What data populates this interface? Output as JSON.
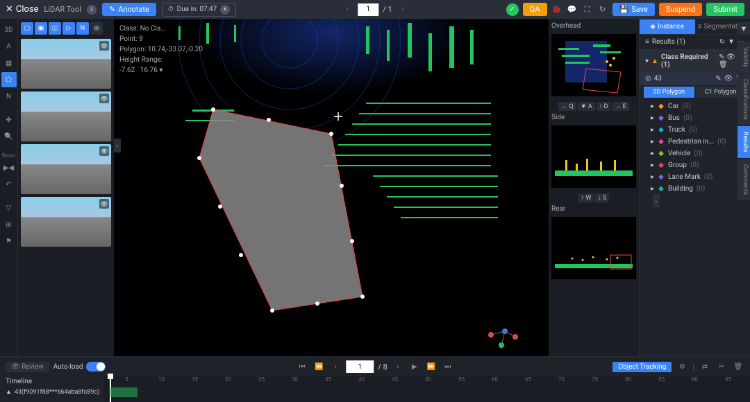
{
  "topbar": {
    "close": "Close",
    "tool_name": "LiDAR Tool",
    "annotate": "Annotate",
    "due_label": "Due in: 07:47",
    "page_current": "1",
    "page_total": "/ 1",
    "qa": "QA",
    "save": "Save",
    "suspend": "Suspend",
    "submit": "Submit"
  },
  "canvas_info": {
    "class_label": "Class:",
    "class_value": "No Cla...",
    "point_label": "Point:",
    "point_value": "9",
    "polygon_label": "Polygon:",
    "polygon_value": "10.74,-33.07,-0.20",
    "height_label": "Height Range:",
    "height_min": "-7.62",
    "height_max": "16.76"
  },
  "side_views": {
    "overhead": "Overhead",
    "side": "Side",
    "rear": "Rear",
    "keys_overhead": [
      "← Q",
      "▼ A",
      "↑ D",
      "→ E"
    ],
    "keys_side": [
      "↑ W",
      "↓ S"
    ]
  },
  "left_tools": {
    "basic_label": "Basic"
  },
  "right_panel": {
    "tab_instance": "Instance",
    "tab_segmentation": "Segmentation",
    "results_label": "Results (1)",
    "class_required": "Class Required (1)",
    "item_id": "43",
    "subtab_3d": "3D Polygon",
    "subtab_c1": "C1 Polygon",
    "classes": [
      {
        "name": "Car",
        "count": "(0)",
        "color": "#f59e0b"
      },
      {
        "name": "Bus",
        "count": "(0)",
        "color": "#a855f7"
      },
      {
        "name": "Truck",
        "count": "(0)",
        "color": "#06b6d4"
      },
      {
        "name": "Pedestrian in...",
        "count": "(0)",
        "color": "#ec4899"
      },
      {
        "name": "Vehicle",
        "count": "(0)",
        "color": "#84cc16"
      },
      {
        "name": "Group",
        "count": "(0)",
        "color": "#f43f5e"
      },
      {
        "name": "Lane Mark",
        "count": "(0)",
        "color": "#8b5cf6"
      },
      {
        "name": "Building",
        "count": "(0)",
        "color": "#14b8a6"
      }
    ]
  },
  "side_tabs": [
    "Validity",
    "Classifications",
    "Results",
    "Comments"
  ],
  "timeline": {
    "review": "Review",
    "autoload": "Auto-load",
    "label": "Timeline",
    "frame_current": "1",
    "frame_total": "/ 8",
    "obj_tracking": "Object Tracking",
    "track_id": "43(f9091f88***664aba8fc89c)",
    "ticks": [
      "5",
      "10",
      "15",
      "20",
      "25",
      "30",
      "35",
      "40",
      "45",
      "50",
      "55",
      "60",
      "65",
      "70",
      "75",
      "80",
      "85",
      "90",
      "95"
    ]
  }
}
